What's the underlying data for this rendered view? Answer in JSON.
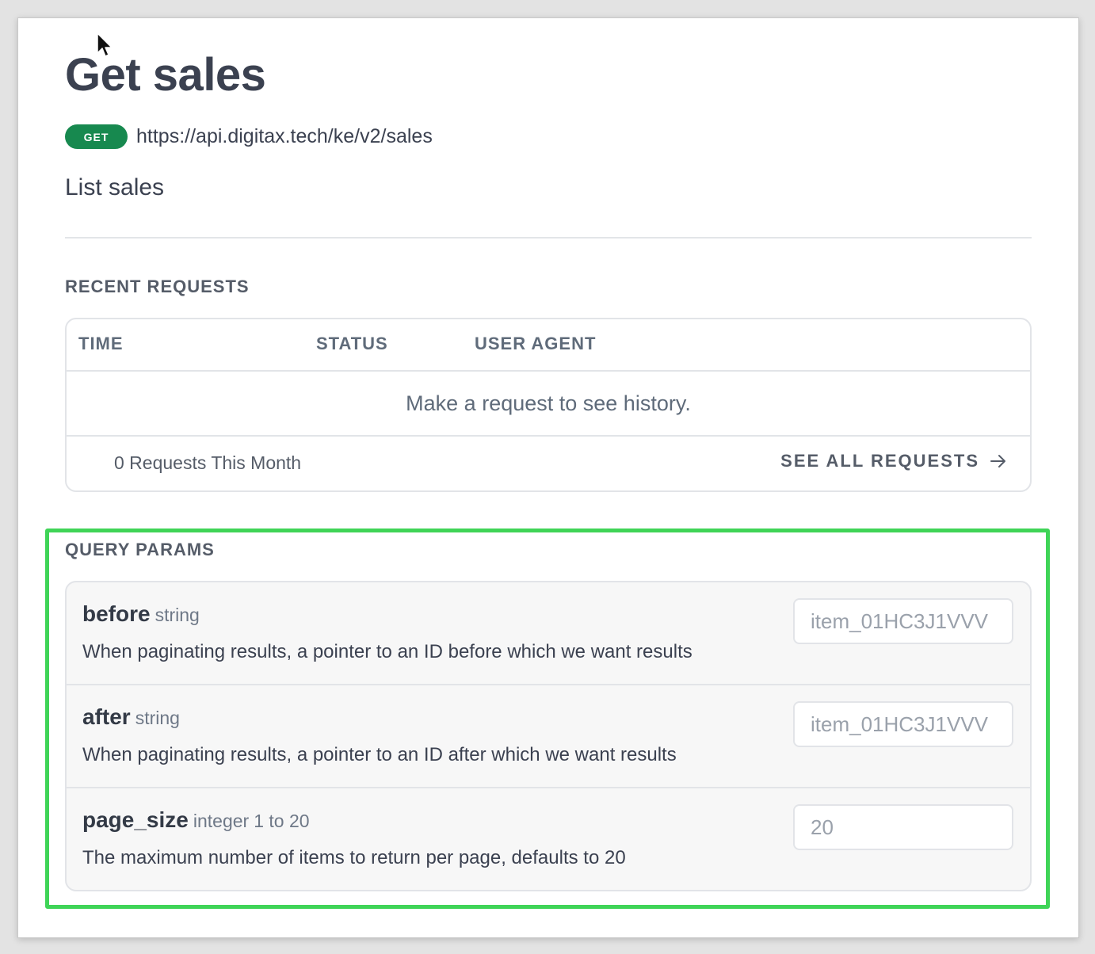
{
  "header": {
    "title": "Get sales",
    "method": "GET",
    "url": "https://api.digitax.tech/ke/v2/sales",
    "description": "List sales"
  },
  "recent_requests": {
    "heading": "RECENT REQUESTS",
    "columns": [
      "TIME",
      "STATUS",
      "USER AGENT"
    ],
    "empty_message": "Make a request to see history.",
    "count_text": "0 Requests This Month",
    "see_all_label": "SEE ALL REQUESTS"
  },
  "query_params": {
    "heading": "QUERY PARAMS",
    "params": [
      {
        "name": "before",
        "type": "string",
        "range": "",
        "description": "When paginating results, a pointer to an ID before which we want results",
        "placeholder": "item_01HC3J1VVV"
      },
      {
        "name": "after",
        "type": "string",
        "range": "",
        "description": "When paginating results, a pointer to an ID after which we want results",
        "placeholder": "item_01HC3J1VVV"
      },
      {
        "name": "page_size",
        "type": "integer",
        "range": "1 to 20",
        "description": "The maximum number of items to return per page, defaults to 20",
        "placeholder": "20"
      }
    ]
  },
  "colors": {
    "method_badge": "#17894f",
    "highlight": "#3fd457",
    "text_primary": "#3b4150"
  }
}
